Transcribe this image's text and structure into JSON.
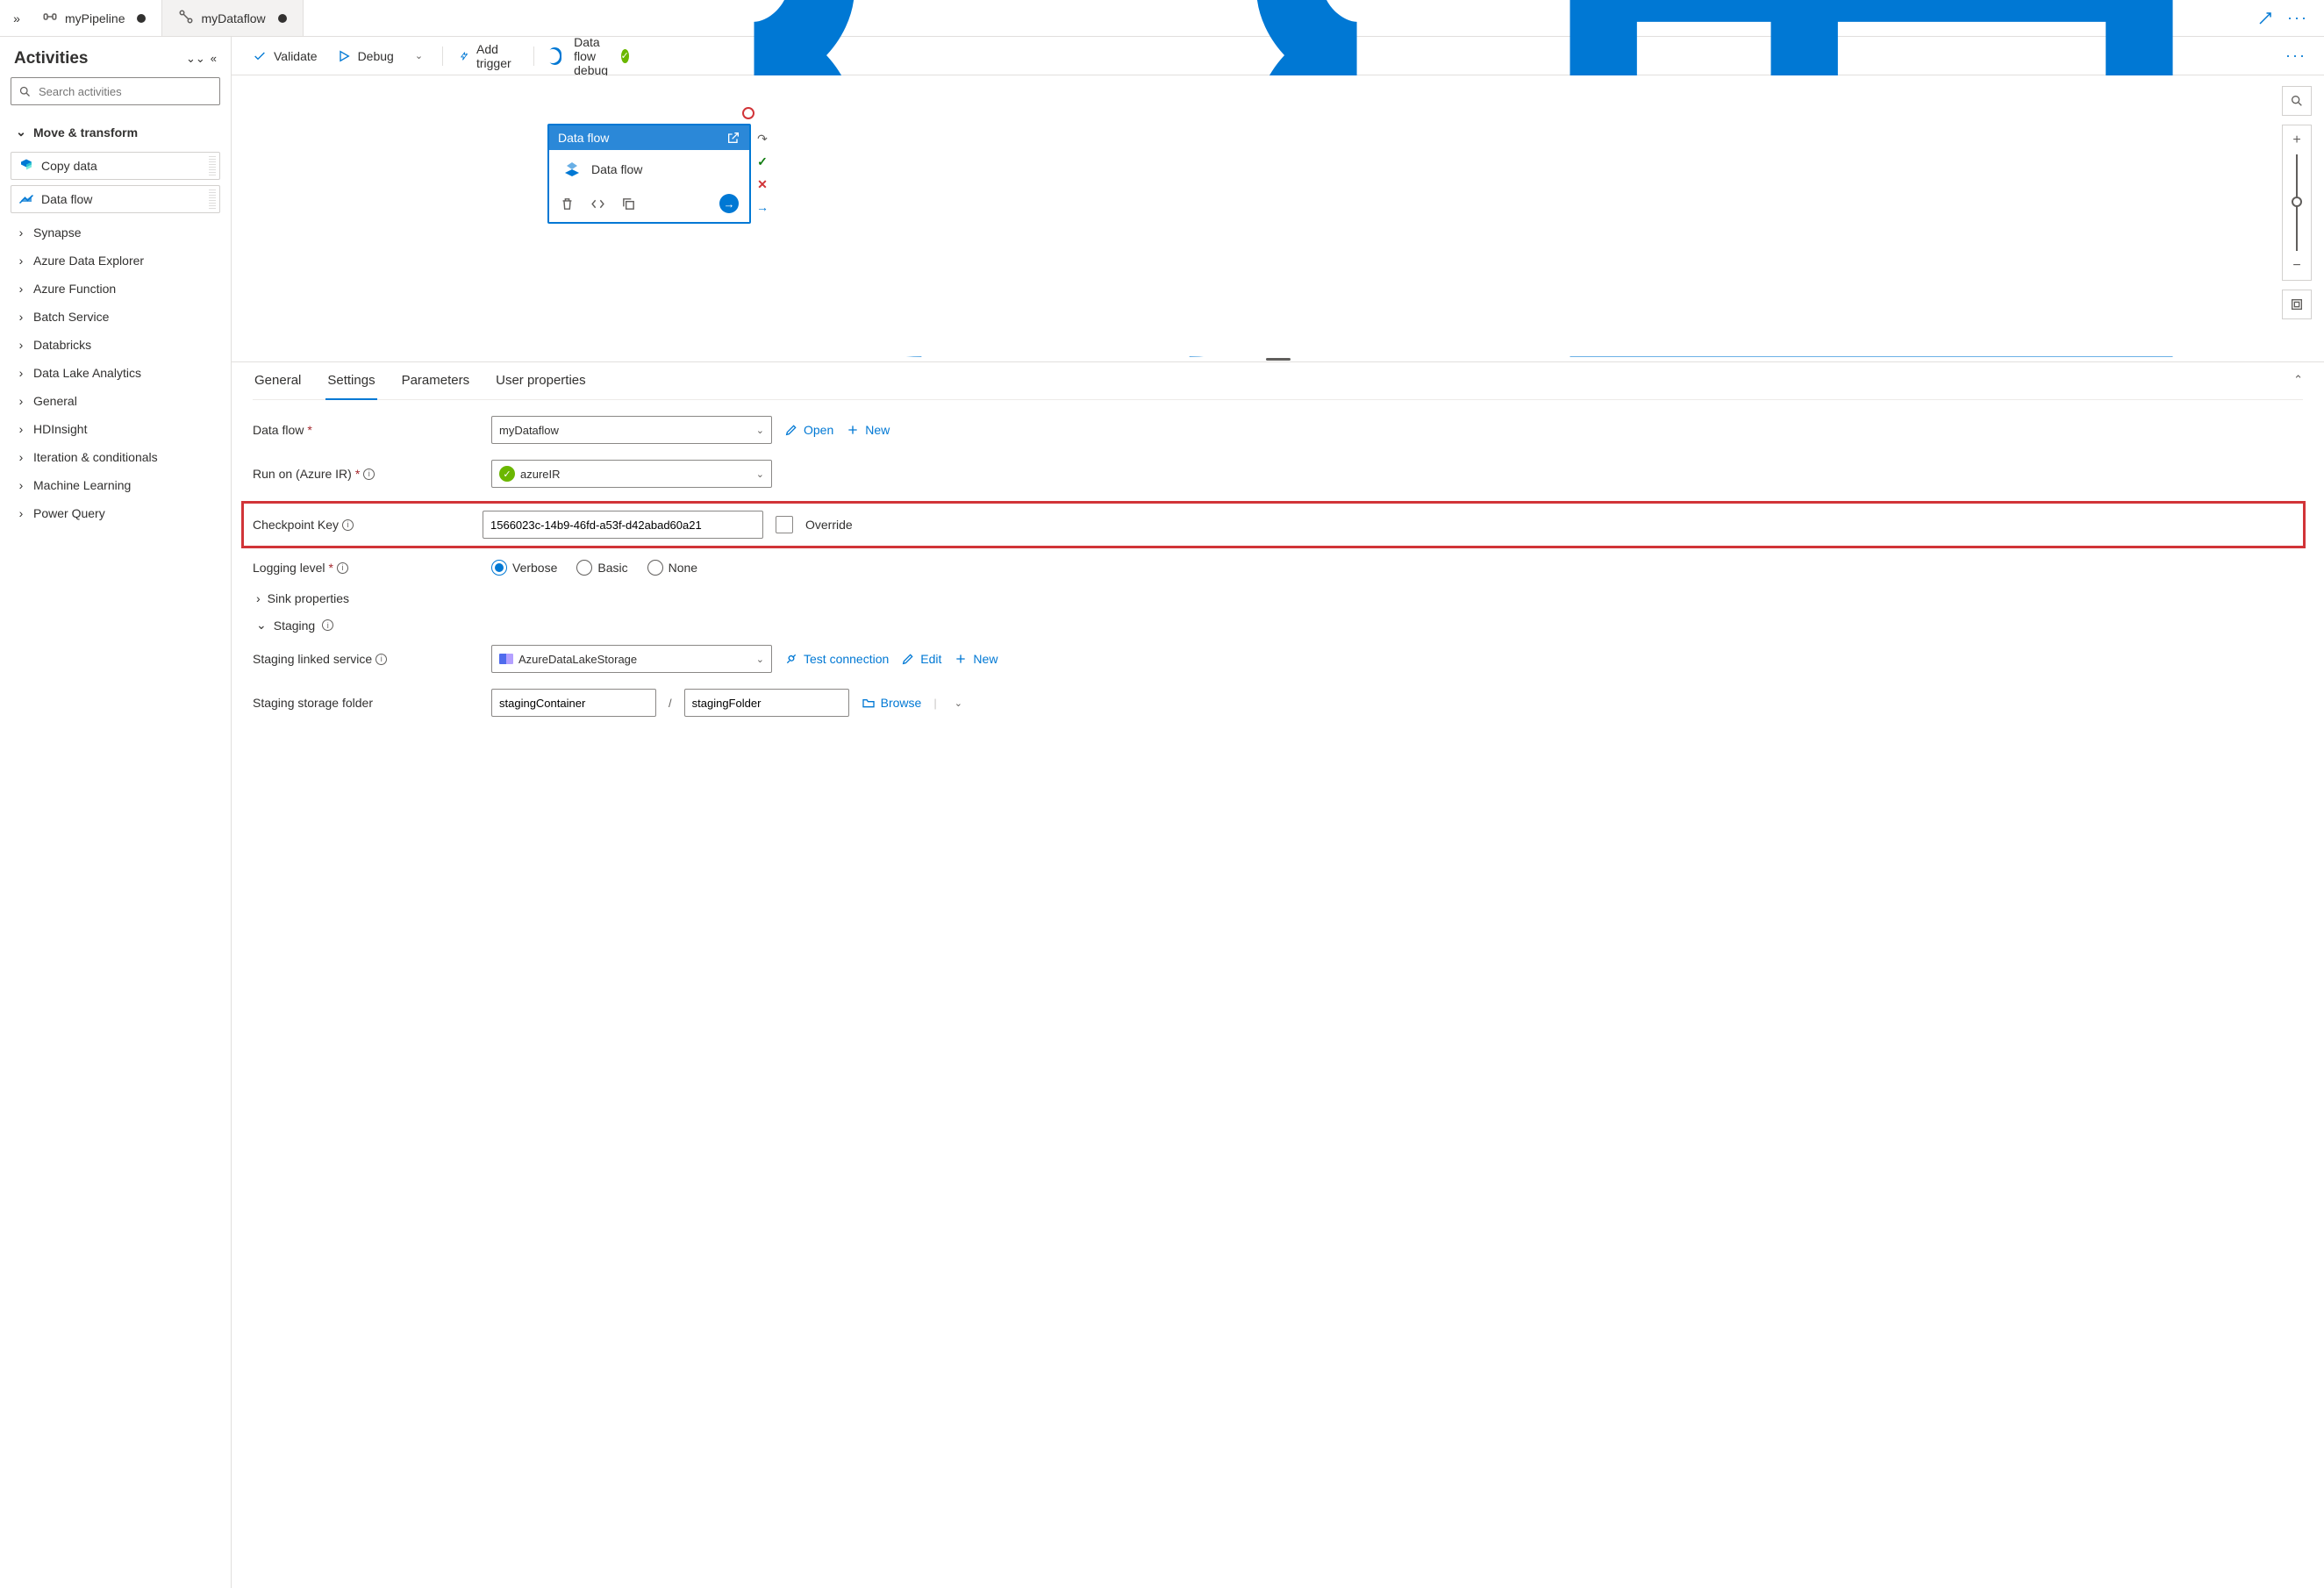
{
  "tabs": [
    {
      "label": "myPipeline",
      "active": true,
      "dirty": true
    },
    {
      "label": "myDataflow",
      "active": false,
      "dirty": true
    }
  ],
  "sidebar": {
    "title": "Activities",
    "search_placeholder": "Search activities",
    "open_category": "Move & transform",
    "cards": [
      {
        "label": "Copy data"
      },
      {
        "label": "Data flow"
      }
    ],
    "categories": [
      "Synapse",
      "Azure Data Explorer",
      "Azure Function",
      "Batch Service",
      "Databricks",
      "Data Lake Analytics",
      "General",
      "HDInsight",
      "Iteration & conditionals",
      "Machine Learning",
      "Power Query"
    ]
  },
  "toolbar": {
    "validate": "Validate",
    "debug": "Debug",
    "add_trigger": "Add trigger",
    "dataflow_debug": "Data flow debug"
  },
  "canvas_node": {
    "title": "Data flow",
    "name": "Data flow"
  },
  "panel_tabs": [
    "General",
    "Settings",
    "Parameters",
    "User properties"
  ],
  "active_panel_tab": 1,
  "settings": {
    "labels": {
      "data_flow": "Data flow",
      "run_on": "Run on (Azure IR)",
      "checkpoint": "Checkpoint Key",
      "logging": "Logging level",
      "sink": "Sink properties",
      "staging": "Staging",
      "staging_ls": "Staging linked service",
      "staging_folder": "Staging storage folder"
    },
    "data_flow_value": "myDataflow",
    "open": "Open",
    "new": "New",
    "azure_ir_value": "azureIR",
    "checkpoint_value": "1566023c-14b9-46fd-a53f-d42abad60a21",
    "override": "Override",
    "log_options": [
      "Verbose",
      "Basic",
      "None"
    ],
    "log_selected": 0,
    "staging_ls_value": "AzureDataLakeStorage",
    "test_connection": "Test connection",
    "edit": "Edit",
    "staging_container": "stagingContainer",
    "staging_folder_value": "stagingFolder",
    "browse": "Browse"
  }
}
